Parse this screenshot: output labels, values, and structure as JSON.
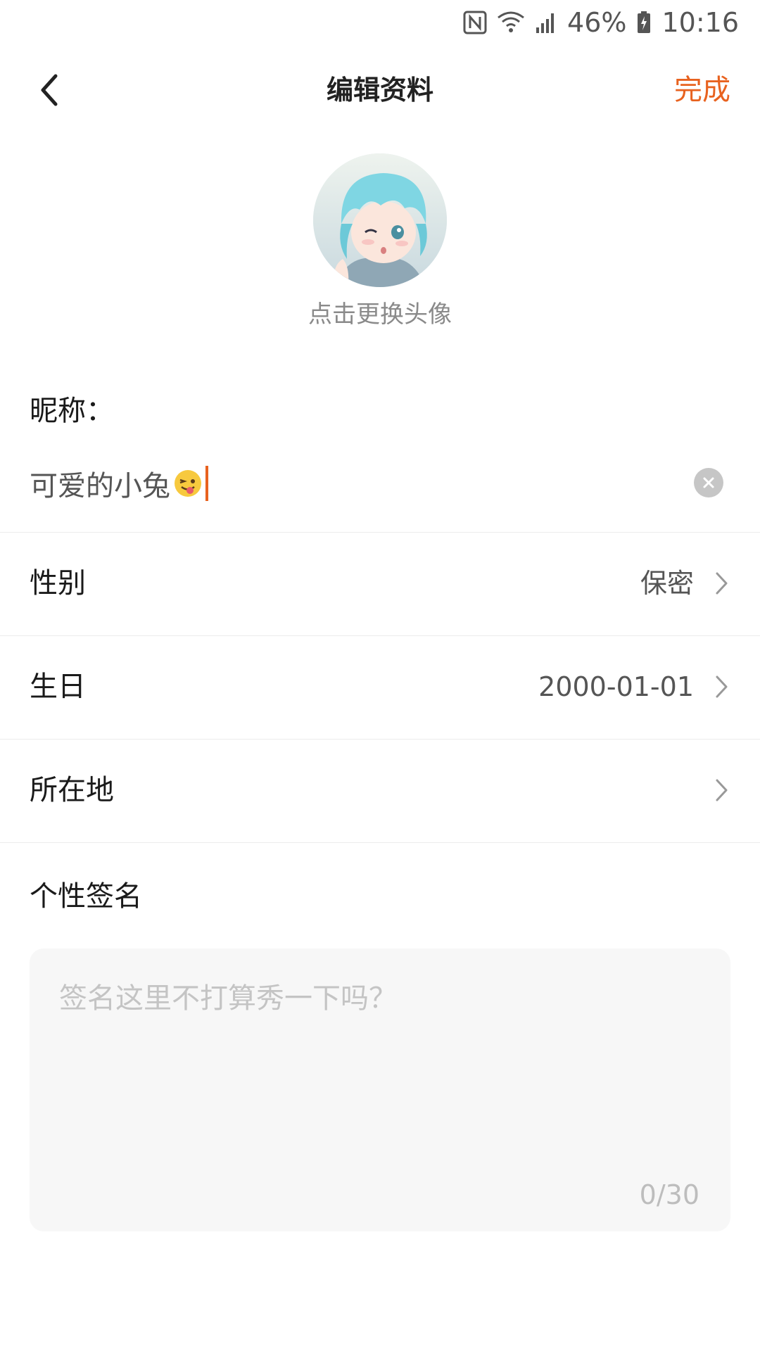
{
  "status_bar": {
    "battery_percent": "46%",
    "time": "10:16",
    "icons": [
      "nfc-icon",
      "wifi-icon",
      "signal-icon",
      "battery-icon"
    ]
  },
  "header": {
    "title": "编辑资料",
    "done_label": "完成",
    "back_icon": "chevron-left-icon"
  },
  "avatar": {
    "hint": "点击更换头像"
  },
  "nickname": {
    "label": "昵称：",
    "value": "可爱的小兔",
    "emoji": "winking-tongue-emoji"
  },
  "rows": [
    {
      "label": "性别",
      "value": "保密"
    },
    {
      "label": "生日",
      "value": "2000-01-01"
    },
    {
      "label": "所在地",
      "value": ""
    }
  ],
  "signature": {
    "label": "个性签名",
    "placeholder": "签名这里不打算秀一下吗？",
    "counter": "0/30"
  },
  "colors": {
    "accent": "#e8621f",
    "divider": "#ececec",
    "box_bg": "#f7f7f7"
  }
}
